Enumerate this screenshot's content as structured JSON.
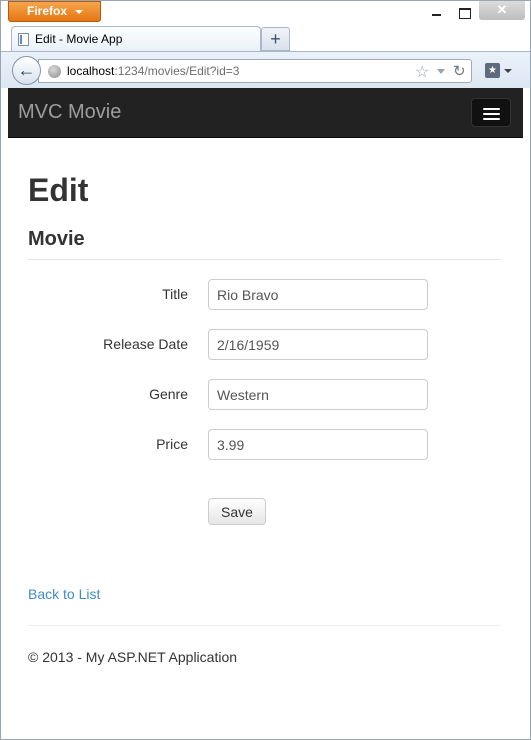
{
  "browser": {
    "menu_button_label": "Firefox",
    "tab_title": "Edit - Movie App",
    "new_tab_label": "+",
    "url_host": "localhost",
    "url_rest": ":1234/movies/Edit?id=3"
  },
  "app": {
    "brand": "MVC Movie"
  },
  "page": {
    "heading": "Edit",
    "subheading": "Movie"
  },
  "form": {
    "fields": [
      {
        "label": "Title",
        "value": "Rio Bravo"
      },
      {
        "label": "Release Date",
        "value": "2/16/1959"
      },
      {
        "label": "Genre",
        "value": "Western"
      },
      {
        "label": "Price",
        "value": "3.99"
      }
    ],
    "save_label": "Save"
  },
  "links": {
    "back_to_list": "Back to List"
  },
  "footer": {
    "text": "© 2013 - My ASP.NET Application"
  },
  "colors": {
    "navbar_bg": "#222222",
    "brand_text": "#9d9d9d",
    "link": "#428bca",
    "firefox_orange": "#e47713"
  },
  "icons": {
    "back": "back-arrow-icon",
    "site": "globe-icon",
    "bookmark_star": "star-icon",
    "reload": "reload-icon",
    "bookmarks_menu": "bookmarks-icon",
    "menu_toggle": "hamburger-icon"
  }
}
